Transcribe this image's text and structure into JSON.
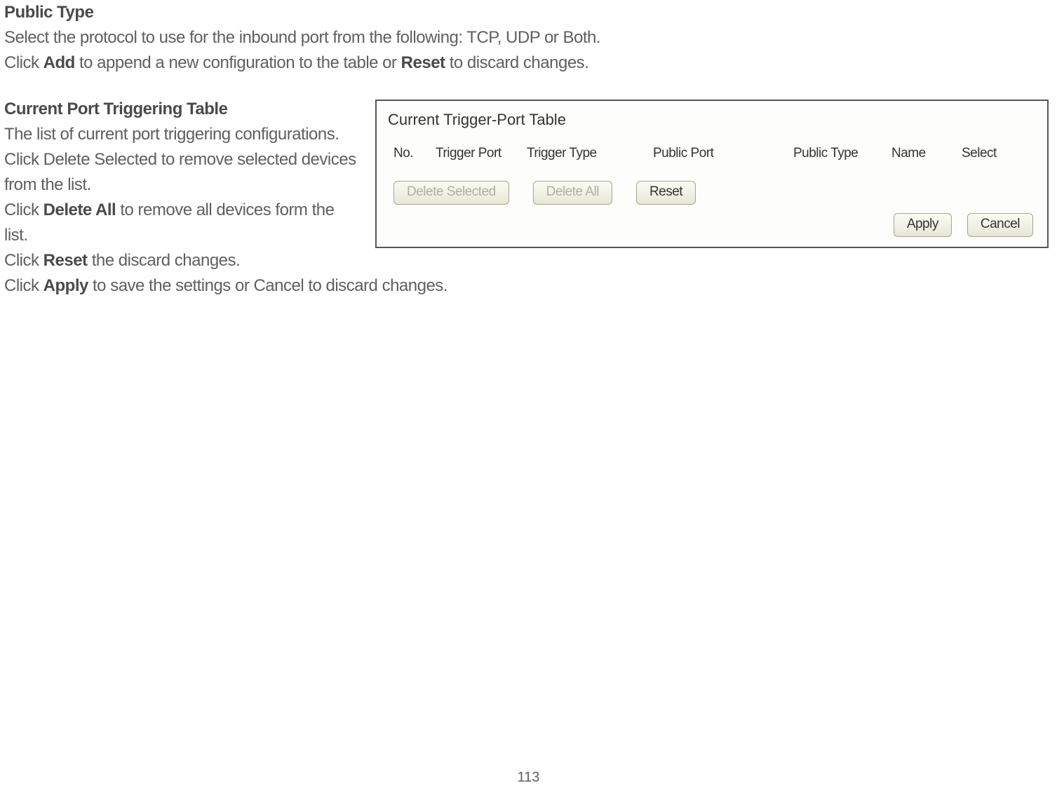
{
  "doc": {
    "heading1": "Public Type",
    "line1": "Select the protocol to use for the inbound port from the following: TCP, UDP or Both.",
    "line2_pre": "Click ",
    "line2_b1": "Add",
    "line2_mid": " to append a new configuration to the table or ",
    "line2_b2": "Reset",
    "line2_post": " to discard changes.",
    "heading2": "Current Port Triggering Table",
    "line3": "The list of current port triggering configurations.",
    "line4a": "Click Delete Selected to remove selected devices",
    "line4b": "from the list.",
    "line5_pre": "Click ",
    "line5_b": "Delete All",
    "line5_post": " to remove all devices form the list.",
    "line6_pre": "Click ",
    "line6_b": "Reset",
    "line6_post": " the discard changes.",
    "line7_pre": "Click ",
    "line7_b": "Apply",
    "line7_post": " to save the settings or Cancel to discard changes.",
    "page_number": "113"
  },
  "panel": {
    "title": "Current Trigger-Port Table",
    "columns": {
      "no": "No.",
      "trigger_port": "Trigger Port",
      "trigger_type": "Trigger Type",
      "public_port": "Public Port",
      "public_type": "Public Type",
      "name": "Name",
      "select": "Select"
    },
    "buttons": {
      "delete_selected": "Delete Selected",
      "delete_all": "Delete All",
      "reset": "Reset",
      "apply": "Apply",
      "cancel": "Cancel"
    }
  }
}
